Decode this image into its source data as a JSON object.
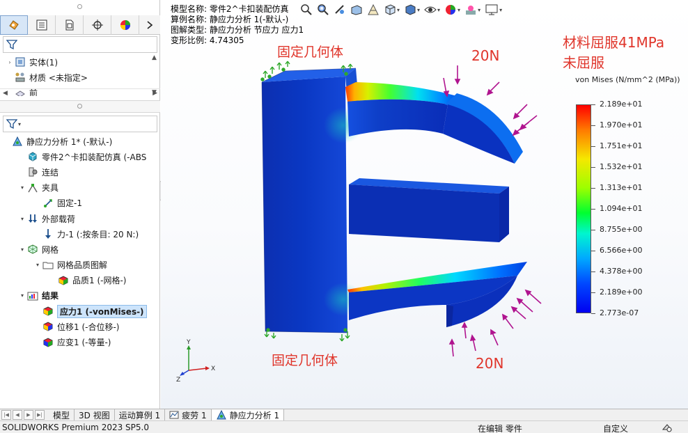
{
  "left_panel": {
    "tabs": [
      {
        "icon": "feature-manager-icon"
      },
      {
        "icon": "property-manager-icon"
      },
      {
        "icon": "configuration-manager-icon"
      },
      {
        "icon": "dimxpert-icon"
      },
      {
        "icon": "display-manager-icon"
      }
    ],
    "top_tree": [
      {
        "label": "实体(1)",
        "icon": "solid-body-icon"
      },
      {
        "label": "材质 <未指定>",
        "icon": "material-icon"
      },
      {
        "label": "前",
        "icon": "plane-icon"
      }
    ],
    "study_tree": [
      {
        "label": "静应力分析 1* (-默认-)",
        "icon": "static-study-icon",
        "indent": 0,
        "expander": ""
      },
      {
        "label": "零件2^卡扣装配仿真 (-ABS",
        "icon": "part-icon",
        "indent": 1,
        "expander": ""
      },
      {
        "label": "连结",
        "icon": "connections-icon",
        "indent": 1,
        "expander": ""
      },
      {
        "label": "夹具",
        "icon": "fixtures-icon",
        "indent": 1,
        "expander": "▾"
      },
      {
        "label": "固定-1",
        "icon": "fixed-geometry-icon",
        "indent": 2,
        "expander": ""
      },
      {
        "label": "外部载荷",
        "icon": "external-loads-icon",
        "indent": 1,
        "expander": "▾"
      },
      {
        "label": "力-1 (:按条目: 20 N:)",
        "icon": "force-icon",
        "indent": 2,
        "expander": ""
      },
      {
        "label": "网格",
        "icon": "mesh-icon",
        "indent": 1,
        "expander": "▾"
      },
      {
        "label": "网格品质图解",
        "icon": "folder-icon",
        "indent": 2,
        "expander": "▾"
      },
      {
        "label": "品质1 (-网格-)",
        "icon": "mesh-quality-plot-icon",
        "indent": 3,
        "expander": ""
      },
      {
        "label": "结果",
        "icon": "results-folder-icon",
        "indent": 1,
        "expander": "▾",
        "bold": true
      },
      {
        "label": "应力1 (-vonMises-)",
        "icon": "stress-plot-icon",
        "indent": 2,
        "expander": "",
        "selected": true
      },
      {
        "label": "位移1 (-合位移-)",
        "icon": "displacement-plot-icon",
        "indent": 2,
        "expander": ""
      },
      {
        "label": "应变1 (-等量-)",
        "icon": "strain-plot-icon",
        "indent": 2,
        "expander": ""
      }
    ]
  },
  "study_info": {
    "model_name": "模型名称: 零件2^卡扣装配仿真",
    "study_name": "算例名称: 静应力分析 1(-默认-)",
    "plot_type": "图解类型: 静应力分析 节应力 应力1",
    "deformation_scale": "变形比例: 4.74305"
  },
  "annotations": {
    "fixed_top": "固定几何体",
    "fixed_bottom": "固定几何体",
    "force_top": "20N",
    "force_bottom": "20N",
    "yield_line1": "材料屈服41MPa",
    "yield_line2": "未屈服"
  },
  "legend": {
    "title": "von Mises (N/mm^2 (MPa))",
    "values": [
      "2.189e+01",
      "1.970e+01",
      "1.751e+01",
      "1.532e+01",
      "1.313e+01",
      "1.094e+01",
      "8.755e+00",
      "6.566e+00",
      "4.378e+00",
      "2.189e+00",
      "2.773e-07"
    ]
  },
  "triad": {
    "x": "X",
    "y": "Y",
    "z": "Z"
  },
  "bottom_tabs": [
    {
      "label": "模型",
      "icon": ""
    },
    {
      "label": "3D 视图",
      "icon": ""
    },
    {
      "label": "运动算例 1",
      "icon": ""
    },
    {
      "label": "疲劳 1",
      "icon": "fatigue-icon"
    },
    {
      "label": "静应力分析 1",
      "icon": "static-study-icon",
      "active": true
    }
  ],
  "status_bar": {
    "product": "SOLIDWORKS Premium 2023 SP5.0",
    "mode": "在编辑 零件",
    "units": "自定义"
  },
  "colors": {
    "annotation_red": "#e0352b",
    "arrow_magenta": "#b0148f",
    "fixture_green": "#2fa82a",
    "selection_blue": "#cde4fb"
  }
}
